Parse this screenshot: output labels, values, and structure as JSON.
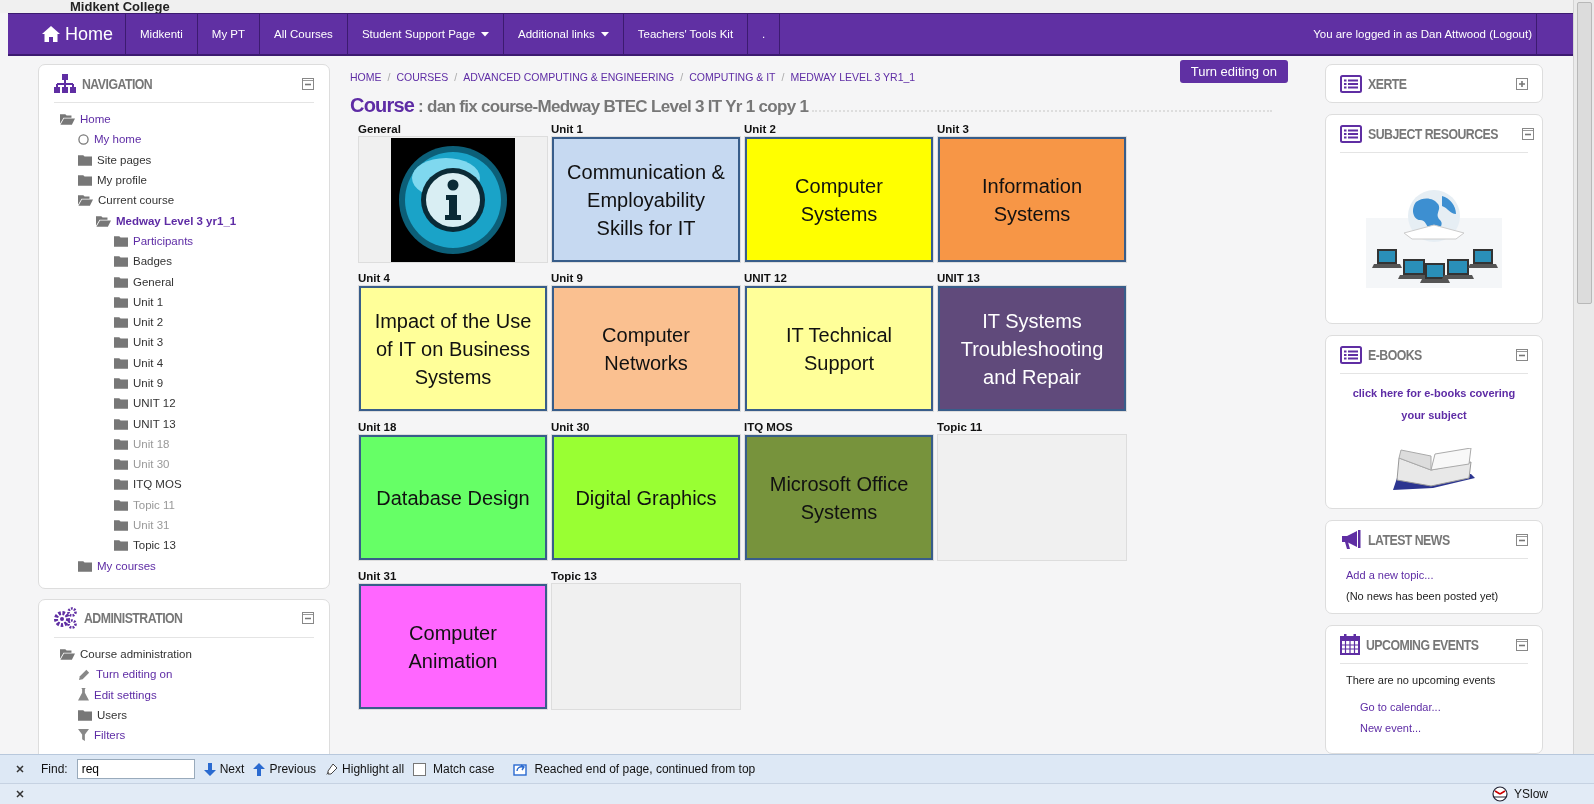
{
  "site_title": "Midkent College",
  "navbar": {
    "home": "Home",
    "items": [
      {
        "label": "Midkenti",
        "dropdown": false
      },
      {
        "label": "My PT",
        "dropdown": false
      },
      {
        "label": "All Courses",
        "dropdown": false
      },
      {
        "label": "Student Support Page",
        "dropdown": true
      },
      {
        "label": "Additional links",
        "dropdown": true
      },
      {
        "label": "Teachers' Tools Kit",
        "dropdown": false
      },
      {
        "label": ".",
        "dropdown": false
      }
    ],
    "login_text": "You are logged in as Dan Attwood (Logout)"
  },
  "navigation": {
    "title": "NAVIGATION",
    "collapsed": false,
    "tree": [
      {
        "label": "Home",
        "kind": "folder",
        "link": true,
        "expanded": true,
        "children": [
          {
            "label": "My home",
            "kind": "page",
            "link": true
          },
          {
            "label": "Site pages",
            "kind": "folder",
            "link": false,
            "expanded": false
          },
          {
            "label": "My profile",
            "kind": "folder",
            "link": false,
            "expanded": false
          },
          {
            "label": "Current course",
            "kind": "folder",
            "link": false,
            "expanded": true,
            "children": [
              {
                "label": "Medway Level 3 yr1_1",
                "kind": "folder",
                "link": true,
                "current": true,
                "expanded": true,
                "children": [
                  {
                    "label": "Participants",
                    "kind": "folder",
                    "link": true,
                    "dimmed": false
                  },
                  {
                    "label": "Badges",
                    "kind": "folder",
                    "link": false,
                    "dimmed": false
                  },
                  {
                    "label": "General",
                    "kind": "folder",
                    "link": false,
                    "dimmed": false
                  },
                  {
                    "label": "Unit 1",
                    "kind": "folder",
                    "link": false,
                    "dimmed": false
                  },
                  {
                    "label": "Unit 2",
                    "kind": "folder",
                    "link": false,
                    "dimmed": false
                  },
                  {
                    "label": "Unit 3",
                    "kind": "folder",
                    "link": false,
                    "dimmed": false
                  },
                  {
                    "label": "Unit 4",
                    "kind": "folder",
                    "link": false,
                    "dimmed": false
                  },
                  {
                    "label": "Unit 9",
                    "kind": "folder",
                    "link": false,
                    "dimmed": false
                  },
                  {
                    "label": "UNIT 12",
                    "kind": "folder",
                    "link": false,
                    "dimmed": false
                  },
                  {
                    "label": "UNIT 13",
                    "kind": "folder",
                    "link": false,
                    "dimmed": false
                  },
                  {
                    "label": "Unit 18",
                    "kind": "folder",
                    "link": false,
                    "dimmed": true
                  },
                  {
                    "label": "Unit 30",
                    "kind": "folder",
                    "link": false,
                    "dimmed": true
                  },
                  {
                    "label": "ITQ MOS",
                    "kind": "folder",
                    "link": false,
                    "dimmed": false
                  },
                  {
                    "label": "Topic 11",
                    "kind": "folder",
                    "link": false,
                    "dimmed": true
                  },
                  {
                    "label": "Unit 31",
                    "kind": "folder",
                    "link": false,
                    "dimmed": true
                  },
                  {
                    "label": "Topic 13",
                    "kind": "folder",
                    "link": false,
                    "dimmed": false
                  }
                ]
              }
            ]
          },
          {
            "label": "My courses",
            "kind": "folder",
            "link": true,
            "expanded": false
          }
        ]
      }
    ]
  },
  "administration": {
    "title": "ADMINISTRATION",
    "collapsed": false,
    "tree": [
      {
        "label": "Course administration",
        "kind": "folder",
        "link": false,
        "expanded": true,
        "children": [
          {
            "label": "Turn editing on",
            "kind": "edit",
            "link": true
          },
          {
            "label": "Edit settings",
            "kind": "settings",
            "link": true
          },
          {
            "label": "Users",
            "kind": "folder",
            "link": false
          },
          {
            "label": "Filters",
            "kind": "filter",
            "link": true
          }
        ]
      }
    ]
  },
  "breadcrumb": {
    "separator": "/",
    "items": [
      "HOME",
      "COURSES",
      "ADVANCED COMPUTING & ENGINEERING",
      "COMPUTING & IT",
      "MEDWAY LEVEL 3 YR1_1"
    ]
  },
  "edit_button": "Turn editing on",
  "course_heading": {
    "prefix": "Course",
    "title": ": dan fix course-Medway BTEC Level 3 IT Yr 1 copy 1"
  },
  "sections": [
    {
      "label": "General",
      "kind": "image"
    },
    {
      "label": "Unit 1",
      "kind": "tile",
      "title": "Communication & Employability Skills for IT",
      "color": "#c6d9f1"
    },
    {
      "label": "Unit 2",
      "kind": "tile",
      "title": "Computer Systems",
      "color": "#ffff00"
    },
    {
      "label": "Unit 3",
      "kind": "tile",
      "title": "Information Systems",
      "color": "#f79646"
    },
    {
      "label": "Unit 4",
      "kind": "tile",
      "title": "Impact of the Use of IT on Business Systems",
      "color": "#ffff99"
    },
    {
      "label": "Unit 9",
      "kind": "tile",
      "title": "Computer Networks",
      "color": "#fac090"
    },
    {
      "label": "UNIT 12",
      "kind": "tile",
      "title": "IT Technical Support",
      "color": "#ffff99"
    },
    {
      "label": "UNIT 13",
      "kind": "tile",
      "title": "IT Systems Troubleshooting and Repair",
      "color": "#604a7b"
    },
    {
      "label": "Unit 18",
      "kind": "tile",
      "title": "Database Design",
      "color": "#66ff66"
    },
    {
      "label": "Unit 30",
      "kind": "tile",
      "title": "Digital Graphics",
      "color": "#99ff33"
    },
    {
      "label": "ITQ MOS",
      "kind": "tile",
      "title": "Microsoft Office Systems",
      "color": "#77933c"
    },
    {
      "label": "Topic 11",
      "kind": "empty"
    },
    {
      "label": "Unit 31",
      "kind": "tile",
      "title": "Computer Animation",
      "color": "#ff66ff"
    },
    {
      "label": "Topic 13",
      "kind": "empty"
    }
  ],
  "blocks": [
    {
      "title": "XERTE",
      "kind": "list",
      "collapsed": true
    },
    {
      "title": "SUBJECT RESOURCES",
      "kind": "resources",
      "collapsed": false
    },
    {
      "title": "E-BOOKS",
      "kind": "ebooks",
      "collapsed": false,
      "link": "click here for e-books covering your subject"
    },
    {
      "title": "LATEST NEWS",
      "kind": "news",
      "collapsed": false,
      "links": [
        "Add a new topic..."
      ],
      "note": "(No news has been posted yet)"
    },
    {
      "title": "UPCOMING EVENTS",
      "kind": "events",
      "collapsed": false,
      "note": "There are no upcoming events",
      "links": [
        "Go to calendar...",
        "New event..."
      ]
    }
  ],
  "find_bar": {
    "label": "Find:",
    "value": "req",
    "next": "Next",
    "previous": "Previous",
    "highlight_all": "Highlight all",
    "match_case": {
      "label": "Match case",
      "checked": false
    },
    "message": "Reached end of page, continued from top"
  },
  "status_bar": {
    "addon": "YSlow"
  }
}
